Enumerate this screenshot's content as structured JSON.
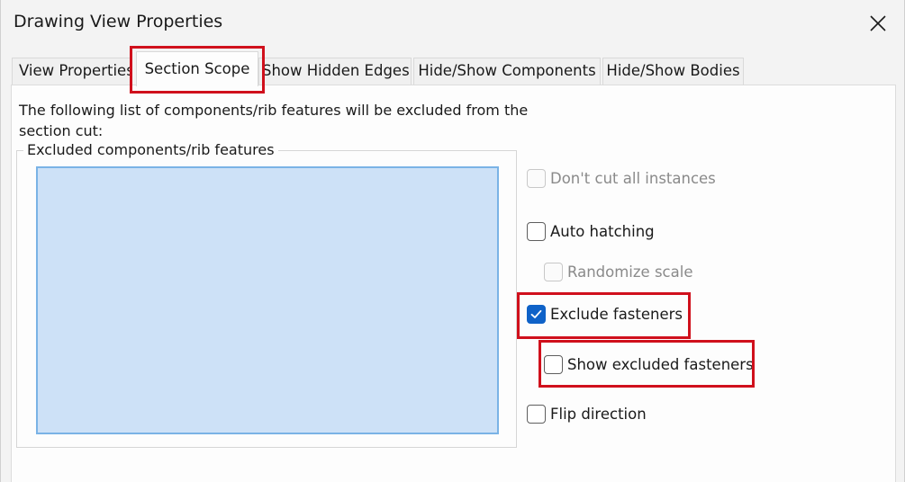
{
  "window": {
    "title": "Drawing View Properties",
    "close_glyph": "close-icon"
  },
  "tabs": [
    {
      "label": "View Properties",
      "active": false
    },
    {
      "label": "Section Scope",
      "active": true
    },
    {
      "label": "Show Hidden Edges",
      "active": false
    },
    {
      "label": "Hide/Show Components",
      "active": false
    },
    {
      "label": "Hide/Show Bodies",
      "active": false
    }
  ],
  "section_scope": {
    "description": "The following list of components/rib features will be excluded from the section cut:",
    "group_label": "Excluded components/rib features",
    "options": {
      "dont_cut_all_instances": {
        "label": "Don't cut all instances",
        "checked": false,
        "enabled": false
      },
      "auto_hatching": {
        "label": "Auto hatching",
        "checked": false,
        "enabled": true
      },
      "randomize_scale": {
        "label": "Randomize scale",
        "checked": false,
        "enabled": false
      },
      "exclude_fasteners": {
        "label": "Exclude fasteners",
        "checked": true,
        "enabled": true
      },
      "show_excluded_fasteners": {
        "label": "Show excluded fasteners",
        "checked": false,
        "enabled": true
      },
      "flip_direction": {
        "label": "Flip direction",
        "checked": false,
        "enabled": true
      }
    }
  },
  "colors": {
    "highlight": "#d0101c",
    "list_fill": "#cde1f7",
    "checkbox_accent": "#0f62c8"
  }
}
